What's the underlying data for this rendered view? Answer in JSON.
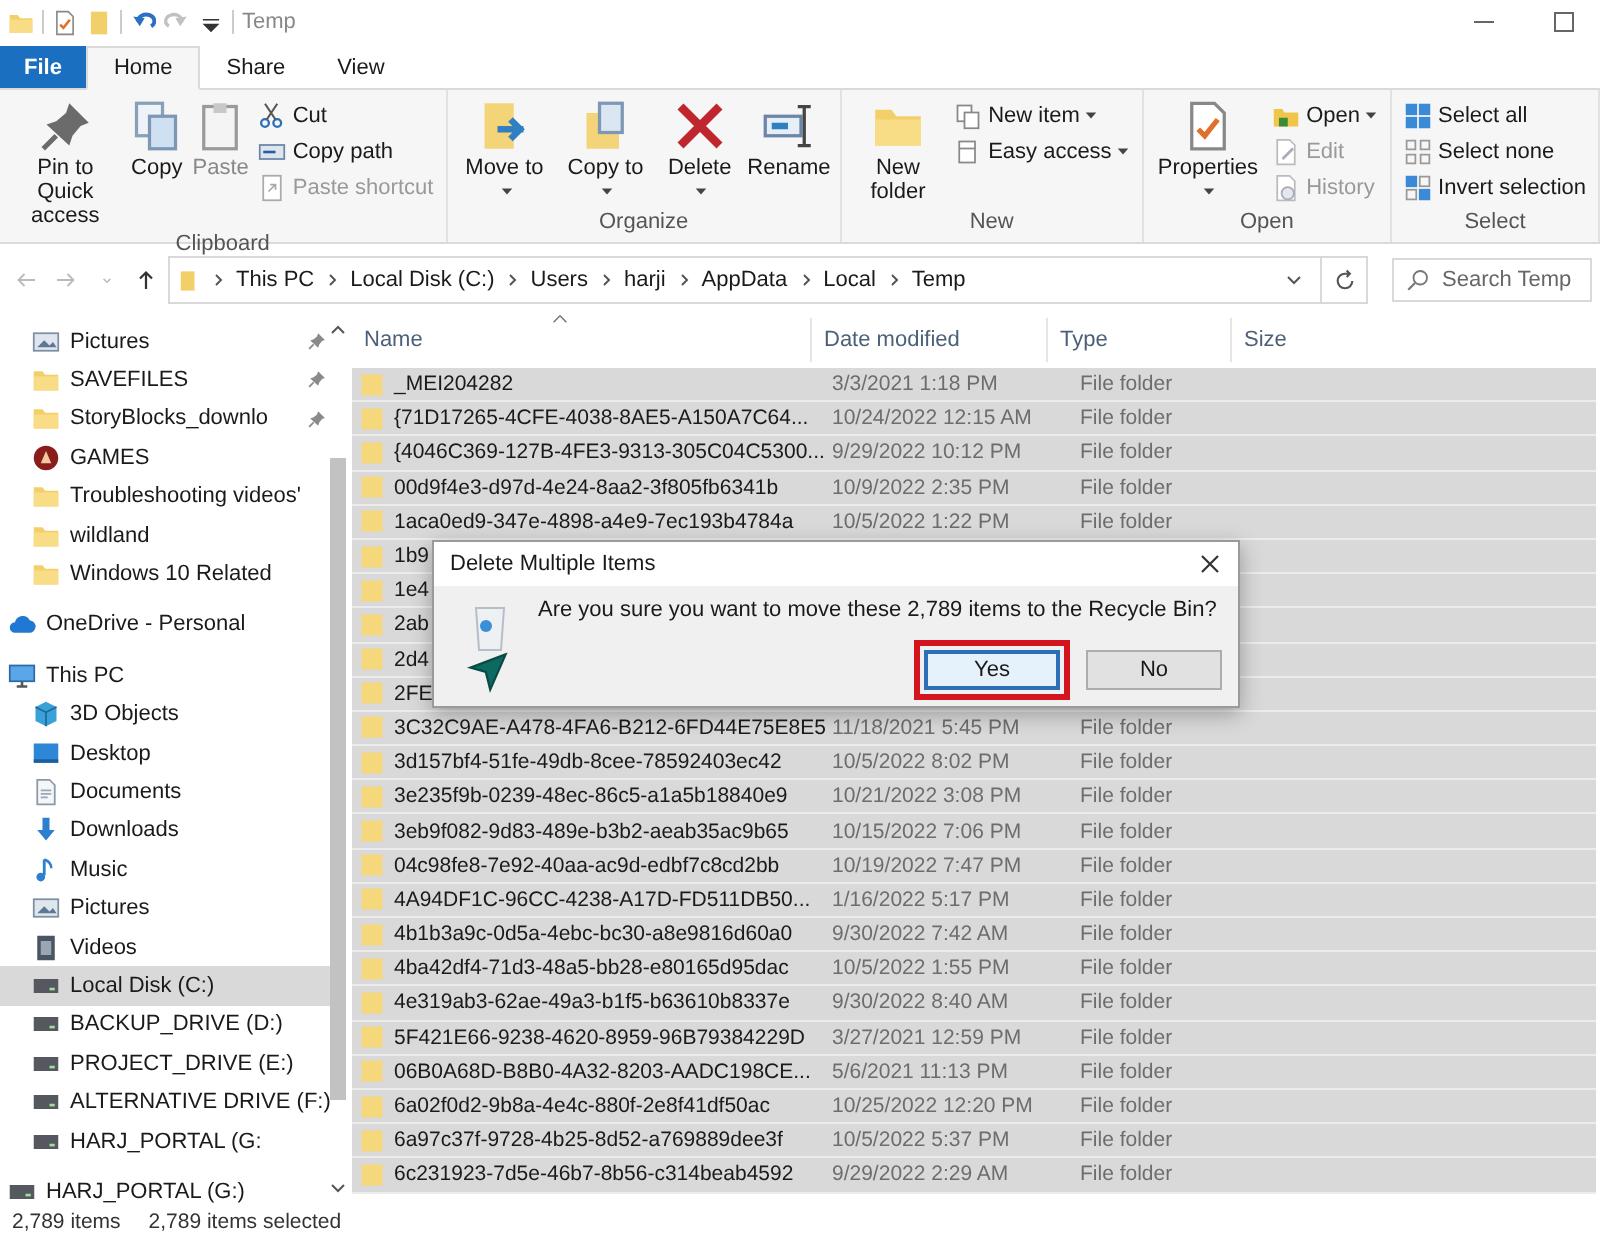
{
  "window": {
    "title": "Temp",
    "quick_access": [
      {
        "kind": "folder",
        "disabled": false
      },
      {
        "kind": "properties",
        "disabled": false
      },
      {
        "kind": "newfolder",
        "disabled": false
      },
      {
        "kind": "undo",
        "disabled": false
      },
      {
        "kind": "redo",
        "disabled": true
      },
      {
        "kind": "customize",
        "disabled": false
      }
    ],
    "controls": [
      {
        "kind": "minimize"
      },
      {
        "kind": "maximize"
      }
    ]
  },
  "ribbon_tabs": [
    {
      "label": "File",
      "kind": "file",
      "selected": false
    },
    {
      "label": "Home",
      "kind": "tab",
      "selected": true
    },
    {
      "label": "Share",
      "kind": "tab",
      "selected": false
    },
    {
      "label": "View",
      "kind": "tab",
      "selected": false
    }
  ],
  "ribbon_groups": [
    {
      "label": "Clipboard",
      "large": [
        {
          "label": "Pin to Quick access",
          "kind": "pin",
          "dropdown": false,
          "disabled": false
        },
        {
          "label": "Copy",
          "kind": "copy",
          "dropdown": false,
          "disabled": false
        },
        {
          "label": "Paste",
          "kind": "paste",
          "dropdown": false,
          "disabled": true
        }
      ],
      "small": [
        {
          "label": "Cut",
          "kind": "scissors",
          "dropdown": false,
          "disabled": false
        },
        {
          "label": "Copy path",
          "kind": "path",
          "dropdown": false,
          "disabled": false
        },
        {
          "label": "Paste shortcut",
          "kind": "shortcut",
          "dropdown": false,
          "disabled": true
        }
      ]
    },
    {
      "label": "Organize",
      "large": [
        {
          "label": "Move to",
          "kind": "moveto",
          "dropdown": true,
          "disabled": false
        },
        {
          "label": "Copy to",
          "kind": "copyto",
          "dropdown": true,
          "disabled": false
        },
        {
          "label": "Delete",
          "kind": "delete",
          "dropdown": true,
          "disabled": false
        },
        {
          "label": "Rename",
          "kind": "rename",
          "dropdown": false,
          "disabled": false
        }
      ]
    },
    {
      "label": "New",
      "large": [
        {
          "label": "New folder",
          "kind": "newfolder",
          "dropdown": false,
          "disabled": false
        }
      ],
      "small": [
        {
          "label": "New item",
          "kind": "newitem",
          "dropdown": true,
          "disabled": false
        },
        {
          "label": "Easy access",
          "kind": "easyaccess",
          "dropdown": true,
          "disabled": false
        }
      ]
    },
    {
      "label": "Open",
      "large": [
        {
          "label": "Properties",
          "kind": "properties",
          "dropdown": true,
          "disabled": false
        }
      ],
      "small": [
        {
          "label": "Open",
          "kind": "open",
          "dropdown": true,
          "disabled": false
        },
        {
          "label": "Edit",
          "kind": "edit",
          "dropdown": false,
          "disabled": true
        },
        {
          "label": "History",
          "kind": "history",
          "dropdown": false,
          "disabled": true
        }
      ]
    },
    {
      "label": "Select",
      "small": [
        {
          "label": "Select all",
          "kind": "selectall",
          "dropdown": false,
          "disabled": false
        },
        {
          "label": "Select none",
          "kind": "selectnone",
          "dropdown": false,
          "disabled": false
        },
        {
          "label": "Invert selection",
          "kind": "invert",
          "dropdown": false,
          "disabled": false
        }
      ]
    }
  ],
  "address_bar": {
    "nav_buttons": [
      {
        "kind": "back",
        "disabled": true
      },
      {
        "kind": "forward",
        "disabled": true
      },
      {
        "kind": "recent",
        "disabled": true
      },
      {
        "kind": "up",
        "disabled": false
      }
    ],
    "path": [
      "This PC",
      "Local Disk (C:)",
      "Users",
      "harji",
      "AppData",
      "Local",
      "Temp"
    ]
  },
  "search": {
    "placeholder": "Search Temp"
  },
  "sidebar": {
    "tree": [
      {
        "children": [
          {
            "label": "Pictures",
            "kind": "picture",
            "pinned": true,
            "selected": false
          },
          {
            "label": "SAVEFILES",
            "kind": "folder",
            "pinned": true,
            "selected": false
          },
          {
            "label": "StoryBlocks_downlo",
            "kind": "folder",
            "pinned": true,
            "selected": false
          },
          {
            "label": "GAMES",
            "kind": "games",
            "pinned": false,
            "selected": false
          },
          {
            "label": "Troubleshooting videos'",
            "kind": "folder",
            "pinned": false,
            "selected": false
          },
          {
            "label": "wildland",
            "kind": "folder",
            "pinned": false,
            "selected": false
          },
          {
            "label": "Windows 10 Related",
            "kind": "folder",
            "pinned": false,
            "selected": false
          }
        ]
      },
      {
        "label": "OneDrive - Personal",
        "kind": "onedrive",
        "selected": false
      },
      {
        "label": "This PC",
        "kind": "pc",
        "selected": false,
        "children": [
          {
            "label": "3D Objects",
            "kind": "cube",
            "selected": false
          },
          {
            "label": "Desktop",
            "kind": "desktop",
            "selected": false
          },
          {
            "label": "Documents",
            "kind": "documents",
            "selected": false
          },
          {
            "label": "Downloads",
            "kind": "downloads",
            "selected": false
          },
          {
            "label": "Music",
            "kind": "music",
            "selected": false
          },
          {
            "label": "Pictures",
            "kind": "picture",
            "selected": false
          },
          {
            "label": "Videos",
            "kind": "videos",
            "selected": false
          },
          {
            "label": "Local Disk (C:)",
            "kind": "drive",
            "selected": true
          },
          {
            "label": "BACKUP_DRIVE (D:)",
            "kind": "drive",
            "selected": false
          },
          {
            "label": "PROJECT_DRIVE (E:)",
            "kind": "drive",
            "selected": false
          },
          {
            "label": "ALTERNATIVE DRIVE (F:)",
            "kind": "drive",
            "selected": false
          },
          {
            "label": "HARJ_PORTAL (G:",
            "kind": "drive",
            "selected": false
          }
        ]
      },
      {
        "label": "HARJ_PORTAL (G:)",
        "kind": "drive",
        "selected": false
      }
    ]
  },
  "table": {
    "columns": [
      "Name",
      "Date modified",
      "Type",
      "Size"
    ],
    "rows": [
      {
        "name": "_MEI204282",
        "date": "3/3/2021 1:18 PM",
        "type": "File folder",
        "selected": true
      },
      {
        "name": "{71D17265-4CFE-4038-8AE5-A150A7C64...",
        "date": "10/24/2022 12:15 AM",
        "type": "File folder",
        "selected": true
      },
      {
        "name": "{4046C369-127B-4FE3-9313-305C04C5300...",
        "date": "9/29/2022 10:12 PM",
        "type": "File folder",
        "selected": true
      },
      {
        "name": "00d9f4e3-d97d-4e24-8aa2-3f805fb6341b",
        "date": "10/9/2022 2:35 PM",
        "type": "File folder",
        "selected": true
      },
      {
        "name": "1aca0ed9-347e-4898-a4e9-7ec193b4784a",
        "date": "10/5/2022 1:22 PM",
        "type": "File folder",
        "selected": true
      },
      {
        "name": "1b9",
        "selected": true
      },
      {
        "name": "1e4",
        "selected": true
      },
      {
        "name": "2ab",
        "selected": true
      },
      {
        "name": "2d4",
        "selected": true
      },
      {
        "name": "2FE",
        "selected": true
      },
      {
        "name": "3C32C9AE-A478-4FA6-B212-6FD44E75E8E5",
        "date": "11/18/2021 5:45 PM",
        "type": "File folder",
        "selected": true
      },
      {
        "name": "3d157bf4-51fe-49db-8cee-78592403ec42",
        "date": "10/5/2022 8:02 PM",
        "type": "File folder",
        "selected": true
      },
      {
        "name": "3e235f9b-0239-48ec-86c5-a1a5b18840e9",
        "date": "10/21/2022 3:08 PM",
        "type": "File folder",
        "selected": true
      },
      {
        "name": "3eb9f082-9d83-489e-b3b2-aeab35ac9b65",
        "date": "10/15/2022 7:06 PM",
        "type": "File folder",
        "selected": true
      },
      {
        "name": "04c98fe8-7e92-40aa-ac9d-edbf7c8cd2bb",
        "date": "10/19/2022 7:47 PM",
        "type": "File folder",
        "selected": true
      },
      {
        "name": "4A94DF1C-96CC-4238-A17D-FD511DB50...",
        "date": "1/16/2022 5:17 PM",
        "type": "File folder",
        "selected": true
      },
      {
        "name": "4b1b3a9c-0d5a-4ebc-bc30-a8e9816d60a0",
        "date": "9/30/2022 7:42 AM",
        "type": "File folder",
        "selected": true
      },
      {
        "name": "4ba42df4-71d3-48a5-bb28-e80165d95dac",
        "date": "10/5/2022 1:55 PM",
        "type": "File folder",
        "selected": true
      },
      {
        "name": "4e319ab3-62ae-49a3-b1f5-b63610b8337e",
        "date": "9/30/2022 8:40 AM",
        "type": "File folder",
        "selected": true
      },
      {
        "name": "5F421E66-9238-4620-8959-96B79384229D",
        "date": "3/27/2021 12:59 PM",
        "type": "File folder",
        "selected": true
      },
      {
        "name": "06B0A68D-B8B0-4A32-8203-AADC198CE...",
        "date": "5/6/2021 11:13 PM",
        "type": "File folder",
        "selected": true
      },
      {
        "name": "6a02f0d2-9b8a-4e4c-880f-2e8f41df50ac",
        "date": "10/25/2022 12:20 PM",
        "type": "File folder",
        "selected": true
      },
      {
        "name": "6a97c37f-9728-4b25-8d52-a769889dee3f",
        "date": "10/5/2022 5:37 PM",
        "type": "File folder",
        "selected": true
      },
      {
        "name": "6c231923-7d5e-46b7-8b56-c314beab4592",
        "date": "9/29/2022 2:29 AM",
        "type": "File folder",
        "selected": true
      }
    ]
  },
  "dialog": {
    "title": "Delete Multiple Items",
    "message": "Are you sure you want to move these 2,789 items to the Recycle Bin?",
    "buttons": [
      {
        "label": "Yes",
        "default": true,
        "highlighted": true
      },
      {
        "label": "No",
        "default": false,
        "highlighted": false
      }
    ]
  },
  "status_bar": {
    "count": "2,789 items",
    "selection": "2,789 items selected"
  }
}
